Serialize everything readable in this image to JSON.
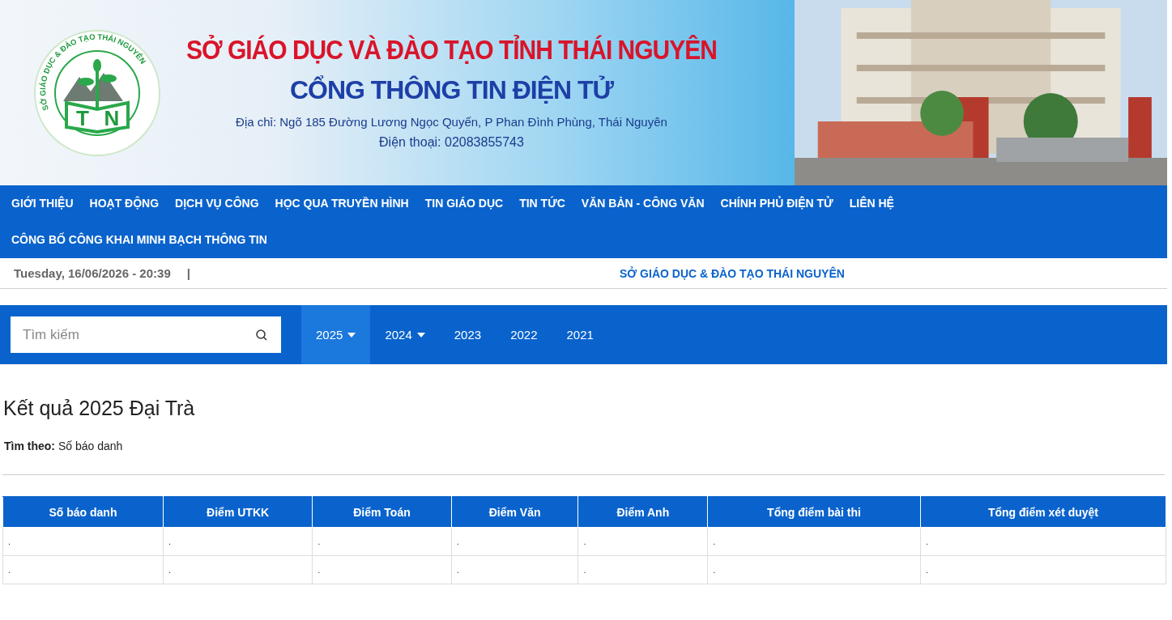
{
  "banner": {
    "logo": {
      "ring_text": "SỞ GIÁO DỤC & ĐÀO TẠO THÁI NGUYÊN",
      "letters": [
        "T",
        "N"
      ]
    },
    "title": "SỞ GIÁO DỤC VÀ ĐÀO TẠO TỈNH THÁI NGUYÊN",
    "subtitle": "CỔNG THÔNG TIN ĐIỆN TỬ",
    "address": "Địa chỉ: Ngõ 185 Đường Lương Ngọc Quyến, P Phan Đình Phùng, Thái Nguyên",
    "phone": "Điện thoại: 02083855743"
  },
  "nav": [
    "GIỚI THIỆU",
    "HOẠT ĐỘNG",
    "DỊCH VỤ CÔNG",
    "HỌC QUA TRUYỀN HÌNH",
    "TIN GIÁO DỤC",
    "TIN TỨC",
    "VĂN BẢN - CÔNG VĂN",
    "CHÍNH PHỦ ĐIỆN TỬ",
    "LIÊN HỆ",
    "CÔNG BỐ CÔNG KHAI MINH BẠCH THÔNG TIN"
  ],
  "info_bar": {
    "datetime": "Tuesday, 16/06/2026 - 20:39",
    "separator": "|",
    "org": "SỞ GIÁO DỤC & ĐÀO TẠO THÁI NGUYÊN"
  },
  "search": {
    "placeholder": "Tìm kiếm"
  },
  "years": [
    {
      "label": "2025",
      "dropdown": true,
      "selected": true
    },
    {
      "label": "2024",
      "dropdown": true,
      "selected": false
    },
    {
      "label": "2023",
      "dropdown": false,
      "selected": false
    },
    {
      "label": "2022",
      "dropdown": false,
      "selected": false
    },
    {
      "label": "2021",
      "dropdown": false,
      "selected": false
    }
  ],
  "heading": "Kết quả 2025 Đại Trà",
  "filter": {
    "label": "Tìm theo:",
    "value": "Số báo danh"
  },
  "table": {
    "columns": [
      "Số báo danh",
      "Điểm UTKK",
      "Điểm Toán",
      "Điểm Văn",
      "Điểm Anh",
      "Tổng điểm bài thi",
      "Tổng điểm xét duyệt"
    ],
    "rows": [
      [
        ".",
        ".",
        ".",
        ".",
        ".",
        ".",
        "."
      ],
      [
        ".",
        ".",
        ".",
        ".",
        ".",
        ".",
        "."
      ]
    ]
  }
}
